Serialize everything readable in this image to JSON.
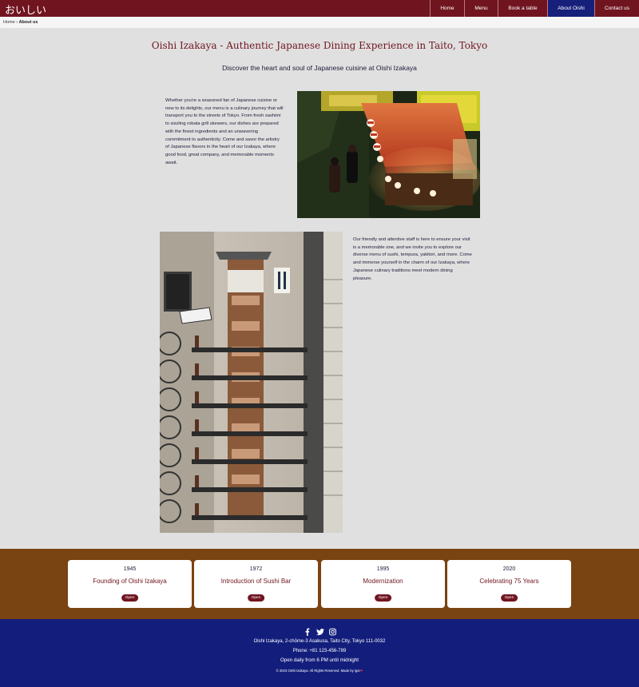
{
  "header": {
    "logo": "おいしい",
    "nav": [
      {
        "label": "Home",
        "active": false
      },
      {
        "label": "Menu",
        "active": false
      },
      {
        "label": "Book a table",
        "active": false
      },
      {
        "label": "About Oishi",
        "active": true
      },
      {
        "label": "Contact us",
        "active": false
      }
    ]
  },
  "breadcrumb": {
    "home": "Home",
    "separator": "›",
    "current": "About us"
  },
  "main": {
    "title": "Oishi Izakaya - Authentic Japanese Dining Experience in Taito, Tokyo",
    "subtitle": "Discover the heart and soul of Japanese cuisine at Oishi Izakaya",
    "paragraph1": "Whether you're a seasoned fan of Japanese cuisine or new to its delights, our menu is a culinary journey that will transport you to the streets of Tokyo. From fresh sashimi to sizzling robata grill skewers, our dishes are prepared with the finest ingredients and an unwavering commitment to authenticity. Come and savor the artistry of Japanese flavors in the heart of our Izakaya, where good food, great company, and memorable moments await.",
    "paragraph2": "Our friendly and attentive staff is here to ensure your visit is a memorable one, and we invite you to explore our diverse menu of sushi, tempura, yakitori, and more. Come and immerse yourself in the charm of our Izakaya, where Japanese culinary traditions meet modern dining pleasure."
  },
  "timeline": [
    {
      "year": "1945",
      "title": "Founding of Oishi Izakaya",
      "button": "Open"
    },
    {
      "year": "1972",
      "title": "Introduction of Sushi Bar",
      "button": "Open"
    },
    {
      "year": "1995",
      "title": "Modernization",
      "button": "Open"
    },
    {
      "year": "2020",
      "title": "Celebrating 75 Years",
      "button": "Open"
    }
  ],
  "footer": {
    "socials": [
      "facebook-icon",
      "twitter-icon",
      "instagram-icon"
    ],
    "address": "Oishi Izakaya, 2-chōme-3 Asakusa, Taito City, Tokyo 111-0032",
    "phone": "Phone: +81 123-456-789",
    "hours": "Open daily from 6 PM until midnight",
    "copyright": "© 2023 Oishi Izakaya. All Rights Reserved. Made by igor",
    "heart": "❤"
  },
  "colors": {
    "brand": "#701520",
    "nav_active": "#16207a",
    "timeline_bg": "#7a4312",
    "footer_bg": "#131e7c",
    "page_bg": "#e0e0e0"
  }
}
